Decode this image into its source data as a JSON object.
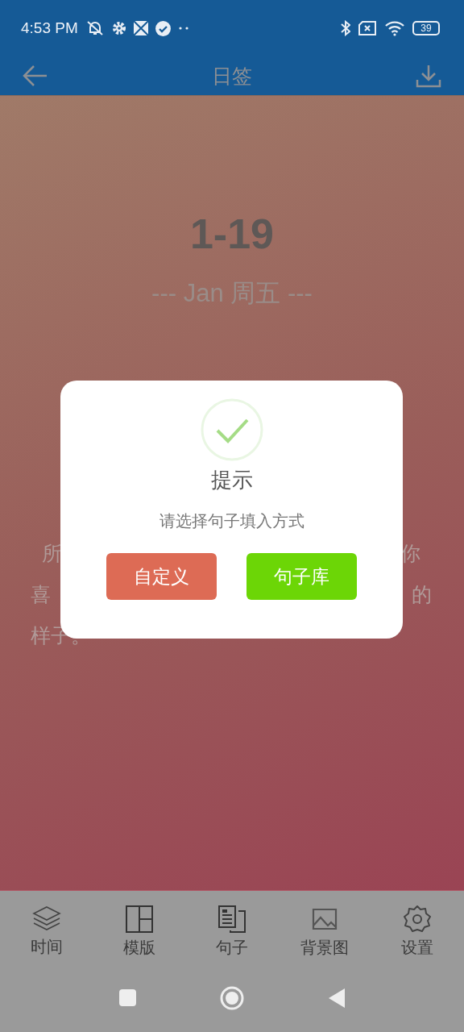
{
  "status_bar": {
    "time": "4:53 PM",
    "battery": "39"
  },
  "app_bar": {
    "title": "日签"
  },
  "card": {
    "date": "1-19",
    "subtitle": "--- Jan  周五 ---",
    "text_lines": [
      {
        "left": "所",
        "right": "你"
      },
      {
        "left": "喜",
        "right": "的"
      },
      {
        "left": "样子。"
      }
    ]
  },
  "dialog": {
    "title": "提示",
    "message": "请选择句子填入方式",
    "buttons": [
      {
        "label": "自定义",
        "kind": "custom"
      },
      {
        "label": "句子库",
        "kind": "library"
      }
    ]
  },
  "bottom_nav": [
    {
      "label": "时间",
      "kind": "layers"
    },
    {
      "label": "模版",
      "kind": "template"
    },
    {
      "label": "句子",
      "kind": "sentence"
    },
    {
      "label": "背景图",
      "kind": "image"
    },
    {
      "label": "设置",
      "kind": "settings"
    }
  ]
}
